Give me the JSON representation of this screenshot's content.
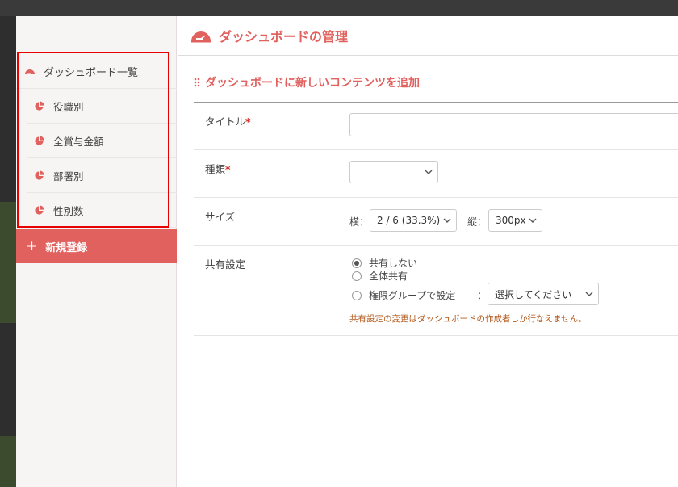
{
  "sidebar": {
    "items": [
      {
        "label": "ダッシュボード一覧",
        "icon": "dashboard-icon"
      },
      {
        "label": "役職別",
        "icon": "pie-chart-icon"
      },
      {
        "label": "全賞与金額",
        "icon": "pie-chart-icon"
      },
      {
        "label": "部署別",
        "icon": "pie-chart-icon"
      },
      {
        "label": "性別数",
        "icon": "pie-chart-icon"
      }
    ],
    "new_button": {
      "label": "新規登録",
      "icon": "plus-icon"
    }
  },
  "header": {
    "title": "ダッシュボードの管理",
    "icon": "dashboard-icon"
  },
  "section": {
    "title": "ダッシュボードに新しいコンテンツを追加",
    "icon": "grip-icon"
  },
  "form": {
    "title_label": "タイトル",
    "title_value": "",
    "required_mark": "*",
    "type_label": "種類",
    "type_value": "",
    "size_label": "サイズ",
    "width_label": "横：",
    "width_value": "2 / 6 (33.3%)",
    "height_label": "縦：",
    "height_value": "300px",
    "share_label": "共有設定",
    "share_options": [
      "共有しない",
      "全体共有",
      "権限グループで設定"
    ],
    "share_selected": "共有しない",
    "group_colon": "：",
    "group_select_value": "選択してください",
    "share_note": "共有設定の変更はダッシュボードの作成者しか行なえません。"
  },
  "colors": {
    "accent": "#e0615e",
    "highlight": "#e60000",
    "note": "#b3591d"
  }
}
